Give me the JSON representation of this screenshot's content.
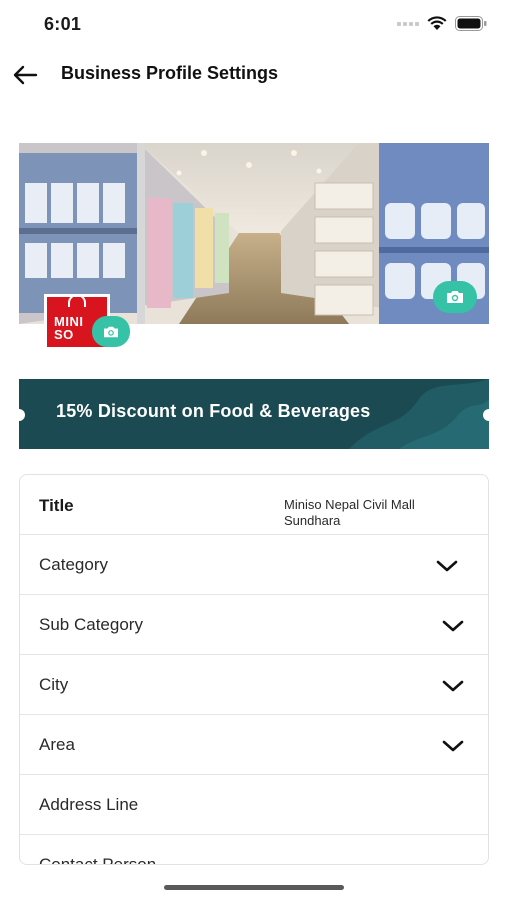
{
  "status_bar": {
    "time": "6:01"
  },
  "header": {
    "title": "Business Profile Settings"
  },
  "cover": {
    "logo_text_line1": "MINI",
    "logo_text_line2": "SO",
    "accent_color": "#36c2a6"
  },
  "promo": {
    "text": "15% Discount on Food & Beverages",
    "bg_color": "#1b4a52"
  },
  "form": {
    "title_label": "Title",
    "title_value": "Miniso Nepal Civil Mall Sundhara",
    "category_label": "Category",
    "sub_category_label": "Sub Category",
    "city_label": "City",
    "area_label": "Area",
    "address_label": "Address Line",
    "contact_label": "Contact Person"
  }
}
